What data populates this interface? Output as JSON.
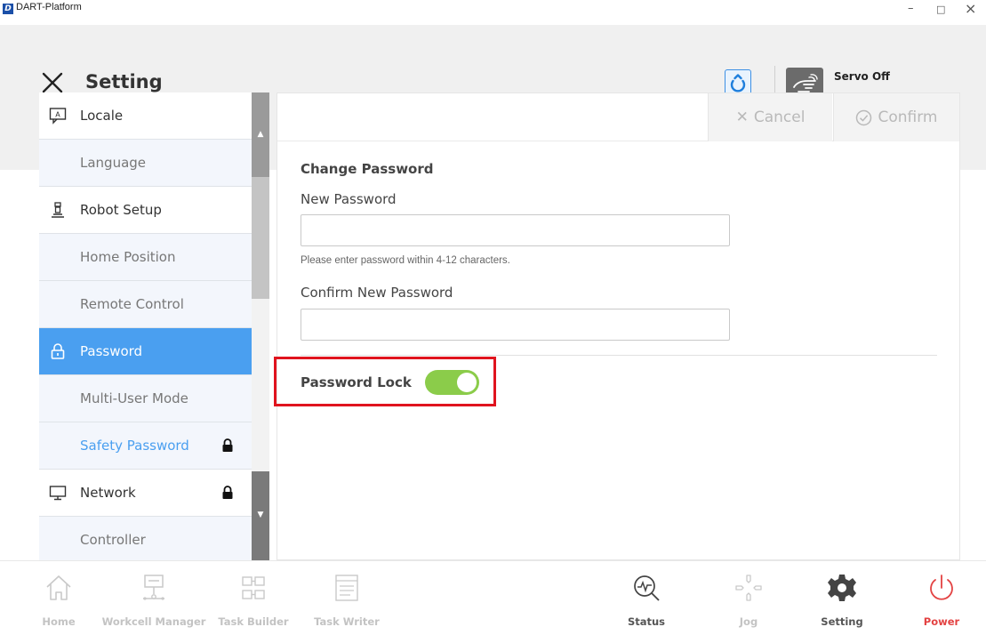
{
  "window": {
    "title": "DART-Platform",
    "logo_letter": "D",
    "minimize": "–",
    "maximize": "□",
    "close": "×"
  },
  "header": {
    "title": "Setting",
    "servo_label": "Servo Off",
    "accent_color": "#4a9ff0"
  },
  "sidebar": {
    "items": [
      {
        "label": "Locale",
        "type": "main",
        "icon": "locale-icon"
      },
      {
        "label": "Language",
        "type": "sub"
      },
      {
        "label": "Robot Setup",
        "type": "main",
        "icon": "robot-icon"
      },
      {
        "label": "Home Position",
        "type": "sub"
      },
      {
        "label": "Remote Control",
        "type": "sub"
      },
      {
        "label": "Password",
        "type": "main",
        "icon": "lock-icon",
        "active": true
      },
      {
        "label": "Multi-User Mode",
        "type": "sub"
      },
      {
        "label": "Safety Password",
        "type": "sub",
        "locked": true
      },
      {
        "label": "Network",
        "type": "main",
        "icon": "monitor-icon",
        "locked": true
      },
      {
        "label": "Controller",
        "type": "sub"
      }
    ]
  },
  "content": {
    "cancel_label": "Cancel",
    "confirm_label": "Confirm",
    "section_title": "Change Password",
    "new_password_label": "New Password",
    "new_password_value": "",
    "hint": "Please enter password within 4-12 characters.",
    "confirm_password_label": "Confirm New Password",
    "confirm_password_value": "",
    "password_lock_label": "Password Lock",
    "password_lock_on": true,
    "toggle_color": "#8bcc4a"
  },
  "bottom_nav": {
    "items": [
      {
        "label": "Home",
        "state": "disabled"
      },
      {
        "label": "Workcell Manager",
        "state": "disabled"
      },
      {
        "label": "Task Builder",
        "state": "disabled"
      },
      {
        "label": "Task Writer",
        "state": "disabled"
      },
      {
        "label": "Status",
        "state": "enabled"
      },
      {
        "label": "Jog",
        "state": "disabled"
      },
      {
        "label": "Setting",
        "state": "enabled"
      },
      {
        "label": "Power",
        "state": "power"
      }
    ],
    "power_color": "#e34242"
  }
}
